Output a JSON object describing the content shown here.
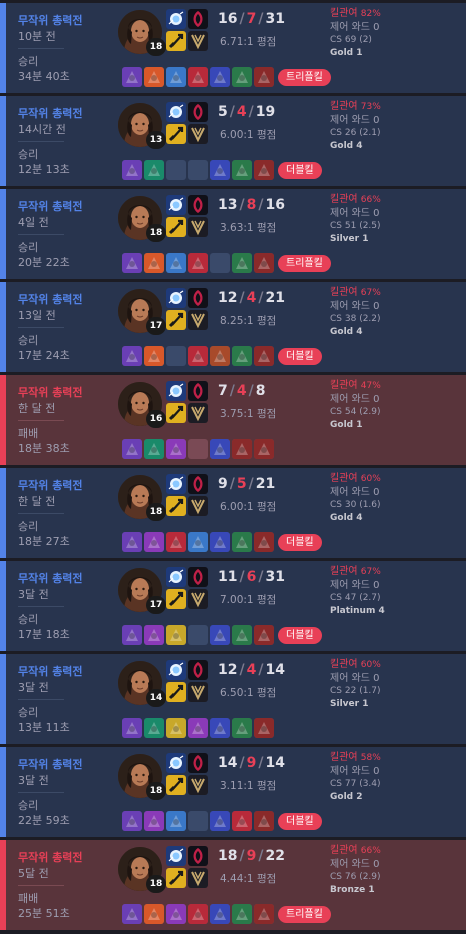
{
  "labels": {
    "kp_label": "킬관여",
    "ward_label": "제어 와드",
    "rating_suffix": "평점",
    "cs_prefix": "CS"
  },
  "colors": {
    "win_accent": "#5383e8",
    "loss_accent": "#e84057",
    "win_bg": "#28344e",
    "loss_bg": "#59343b",
    "badge": "#e84057"
  },
  "icons": {
    "champion": "champion-portrait",
    "spell_1": "flash-spell-icon",
    "spell_2": "ignite-spell-icon",
    "rune_primary": "domination-keystone-icon",
    "rune_secondary": "precision-rune-icon"
  },
  "matches": [
    {
      "result_type": "win",
      "queue": "무작위 총력전",
      "time_ago": "10분 전",
      "result": "승리",
      "duration": "34분 40초",
      "level": "18",
      "kills": "16",
      "deaths": "7",
      "assists": "31",
      "kda_ratio": "6.71:1",
      "kp": "82%",
      "wards": "0",
      "cs": "69 (2)",
      "tier": "Gold 1",
      "badge": "트리플킬",
      "items": [
        "#6a3fb5",
        "#d8582a",
        "#3a78c8",
        "#b82a3a",
        "#3848b8",
        "#2a7a4a",
        "#8a2a2a"
      ]
    },
    {
      "result_type": "win",
      "queue": "무작위 총력전",
      "time_ago": "14시간 전",
      "result": "승리",
      "duration": "12분 13초",
      "level": "13",
      "kills": "5",
      "deaths": "4",
      "assists": "19",
      "kda_ratio": "6.00:1",
      "kp": "73%",
      "wards": "0",
      "cs": "26 (2.1)",
      "tier": "Gold 4",
      "badge": "더블킬",
      "items": [
        "#6a3fb5",
        "#1a8a6a",
        "",
        "",
        "#3848b8",
        "#2a7a4a",
        "#8a2a2a"
      ]
    },
    {
      "result_type": "win",
      "queue": "무작위 총력전",
      "time_ago": "4일 전",
      "result": "승리",
      "duration": "20분 22초",
      "level": "18",
      "kills": "13",
      "deaths": "8",
      "assists": "16",
      "kda_ratio": "3.63:1",
      "kp": "66%",
      "wards": "0",
      "cs": "51 (2.5)",
      "tier": "Silver 1",
      "badge": "트리플킬",
      "items": [
        "#6a3fb5",
        "#d8582a",
        "#3a78c8",
        "#b82a3a",
        "",
        "#2a7a4a",
        "#8a2a2a"
      ]
    },
    {
      "result_type": "win",
      "queue": "무작위 총력전",
      "time_ago": "13일 전",
      "result": "승리",
      "duration": "17분 24초",
      "level": "17",
      "kills": "12",
      "deaths": "4",
      "assists": "21",
      "kda_ratio": "8.25:1",
      "kp": "67%",
      "wards": "0",
      "cs": "38 (2.2)",
      "tier": "Gold 4",
      "badge": "더블킬",
      "items": [
        "#6a3fb5",
        "#d8582a",
        "",
        "#b82a3a",
        "#a84a2a",
        "#2a7a4a",
        "#8a2a2a"
      ]
    },
    {
      "result_type": "loss",
      "queue": "무작위 총력전",
      "time_ago": "한 달 전",
      "result": "패배",
      "duration": "18분 38초",
      "level": "16",
      "kills": "7",
      "deaths": "4",
      "assists": "8",
      "kda_ratio": "3.75:1",
      "kp": "47%",
      "wards": "0",
      "cs": "54 (2.9)",
      "tier": "Gold 1",
      "badge": "",
      "items": [
        "#6a3fb5",
        "#1a8a6a",
        "#8a3ab8",
        "",
        "#3848b8",
        "#8a2a2a",
        "#8a2a2a"
      ]
    },
    {
      "result_type": "win",
      "queue": "무작위 총력전",
      "time_ago": "한 달 전",
      "result": "승리",
      "duration": "18분 27초",
      "level": "18",
      "kills": "9",
      "deaths": "5",
      "assists": "21",
      "kda_ratio": "6.00:1",
      "kp": "60%",
      "wards": "0",
      "cs": "30 (1.6)",
      "tier": "Gold 4",
      "badge": "더블킬",
      "items": [
        "#6a3fb5",
        "#8a3ab8",
        "#b82a3a",
        "#3a78c8",
        "#3848b8",
        "#2a7a4a",
        "#8a2a2a"
      ]
    },
    {
      "result_type": "win",
      "queue": "무작위 총력전",
      "time_ago": "3달 전",
      "result": "승리",
      "duration": "17분 18초",
      "level": "17",
      "kills": "11",
      "deaths": "6",
      "assists": "31",
      "kda_ratio": "7.00:1",
      "kp": "67%",
      "wards": "0",
      "cs": "47 (2.7)",
      "tier": "Platinum 4",
      "badge": "더블킬",
      "items": [
        "#6a3fb5",
        "#8a3ab8",
        "#c8a82a",
        "",
        "#3848b8",
        "#2a7a4a",
        "#8a2a2a"
      ]
    },
    {
      "result_type": "win",
      "queue": "무작위 총력전",
      "time_ago": "3달 전",
      "result": "승리",
      "duration": "13분 11초",
      "level": "14",
      "kills": "12",
      "deaths": "4",
      "assists": "14",
      "kda_ratio": "6.50:1",
      "kp": "60%",
      "wards": "0",
      "cs": "22 (1.7)",
      "tier": "Silver 1",
      "badge": "",
      "items": [
        "#6a3fb5",
        "#1a8a6a",
        "#c8a82a",
        "#8a3ab8",
        "#3848b8",
        "#2a7a4a",
        "#8a2a2a"
      ]
    },
    {
      "result_type": "win",
      "queue": "무작위 총력전",
      "time_ago": "3달 전",
      "result": "승리",
      "duration": "22분 59초",
      "level": "18",
      "kills": "14",
      "deaths": "9",
      "assists": "14",
      "kda_ratio": "3.11:1",
      "kp": "58%",
      "wards": "0",
      "cs": "77 (3.4)",
      "tier": "Gold 2",
      "badge": "더블킬",
      "items": [
        "#6a3fb5",
        "#8a3ab8",
        "#3a78c8",
        "",
        "#3848b8",
        "#b82a3a",
        "#8a2a2a"
      ]
    },
    {
      "result_type": "loss",
      "queue": "무작위 총력전",
      "time_ago": "5달 전",
      "result": "패배",
      "duration": "25분 51초",
      "level": "18",
      "kills": "18",
      "deaths": "9",
      "assists": "22",
      "kda_ratio": "4.44:1",
      "kp": "66%",
      "wards": "0",
      "cs": "76 (2.9)",
      "tier": "Bronze 1",
      "badge": "트리플킬",
      "items": [
        "#6a3fb5",
        "#d8582a",
        "#8a3ab8",
        "#b82a3a",
        "#3848b8",
        "#2a7a4a",
        "#8a2a2a"
      ]
    }
  ]
}
